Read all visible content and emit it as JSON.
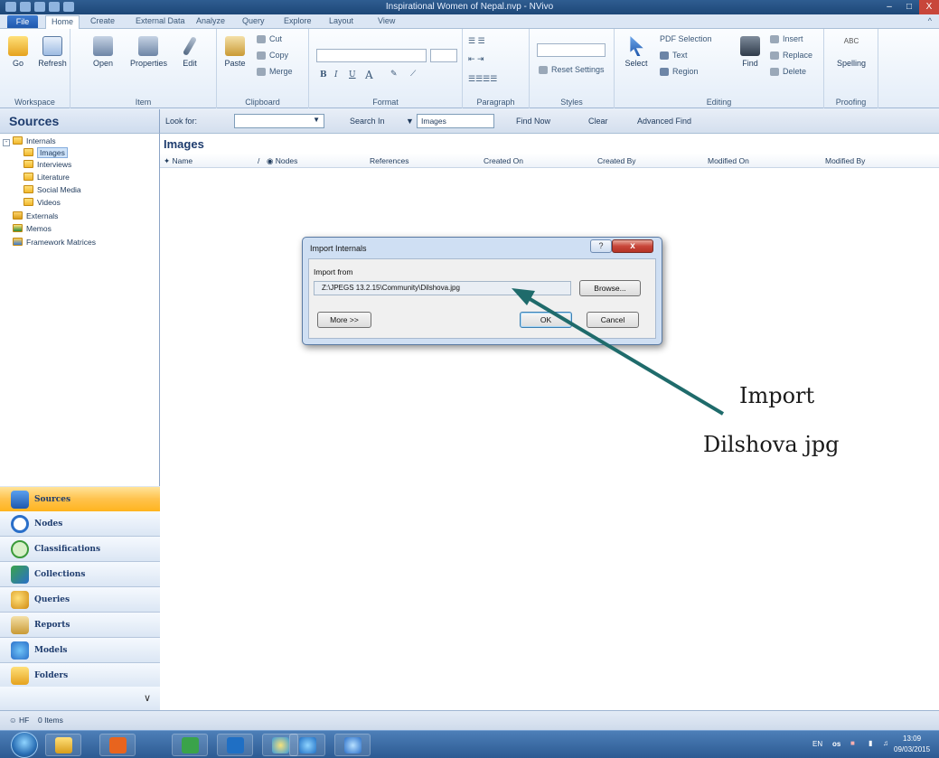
{
  "window": {
    "title": "Inspirational Women of Nepal.nvp - NVivo",
    "qat": [
      "N",
      "S",
      "U",
      "R",
      "v"
    ],
    "controls": [
      "–",
      "□",
      "X"
    ]
  },
  "tabs": [
    "File",
    "Home",
    "Create",
    "External Data",
    "Analyze",
    "Query",
    "Explore",
    "Layout",
    "View"
  ],
  "ribbon": {
    "workspace": {
      "label": "Workspace",
      "go": "Go",
      "refresh": "Refresh"
    },
    "item": {
      "label": "Item",
      "open": "Open",
      "properties": "Properties",
      "edit": "Edit"
    },
    "clipboard": {
      "label": "Clipboard",
      "paste": "Paste",
      "cut": "Cut",
      "copy": "Copy",
      "merge": "Merge"
    },
    "format": {
      "label": "Format",
      "bold": "B",
      "italic": "I",
      "underline": "U",
      "fontcolor": "A"
    },
    "paragraph": {
      "label": "Paragraph"
    },
    "styles": {
      "label": "Styles",
      "reset": "Reset Settings"
    },
    "editing": {
      "label": "Editing",
      "select": "Select",
      "pdf_selection": "PDF Selection",
      "text": "Text",
      "region": "Region",
      "find": "Find",
      "insert": "Insert",
      "replace": "Replace",
      "delete": "Delete"
    },
    "proofing": {
      "label": "Proofing",
      "spelling": "Spelling",
      "abc": "ABC"
    }
  },
  "search": {
    "look_for": "Look for:",
    "search_in": "Search In",
    "scope": "Images",
    "find_now": "Find Now",
    "clear": "Clear",
    "advanced": "Advanced Find"
  },
  "sources": {
    "title": "Sources",
    "tree": {
      "internals": "Internals",
      "children": [
        "Images",
        "Interviews",
        "Literature",
        "Social Media",
        "Videos"
      ],
      "externals": "Externals",
      "memos": "Memos",
      "framework": "Framework Matrices"
    }
  },
  "nav": [
    "Sources",
    "Nodes",
    "Classifications",
    "Collections",
    "Queries",
    "Reports",
    "Models",
    "Folders"
  ],
  "list": {
    "title": "Images",
    "columns": [
      "Name",
      "Nodes",
      "References",
      "Created On",
      "Created By",
      "Modified On",
      "Modified By"
    ]
  },
  "status": {
    "user": "HF",
    "items": "0 Items"
  },
  "dialog": {
    "title": "Import Internals",
    "help": "?",
    "close": "x",
    "import_from": "Import from",
    "path": "Z:\\JPEGS 13.2.15\\Community\\Dilshova.jpg",
    "browse": "Browse...",
    "more": "More >>",
    "ok": "OK",
    "cancel": "Cancel"
  },
  "annotation": {
    "line1": "Import",
    "line2": "Dilshova jpg",
    "arrow_color": "#1f6b6b"
  },
  "tray": {
    "lang": "EN",
    "time": "13:09",
    "date": "09/03/2015",
    "os": "os"
  }
}
